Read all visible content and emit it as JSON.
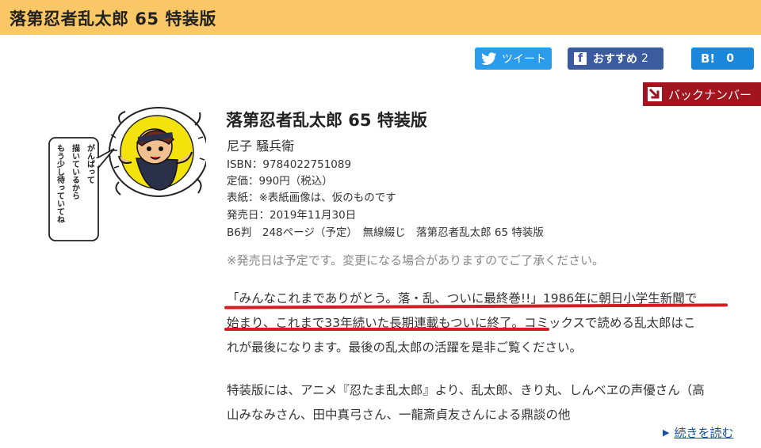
{
  "page": {
    "header_title": "落第忍者乱太郎 65 特装版"
  },
  "share": {
    "tweet_label": "ツイート",
    "fb_icon": "f",
    "fb_label": "おすすめ",
    "fb_count": "2",
    "hatena_icon": "B!",
    "hatena_count": "0"
  },
  "back_number": {
    "label": "バックナンバー"
  },
  "illustration": {
    "speech_col1": "がんばって",
    "speech_col2": "描いているから",
    "speech_col3": "もう少し待っていてね"
  },
  "book": {
    "title": "落第忍者乱太郎 65 特装版",
    "author": "尼子 騒兵衛",
    "isbn": "ISBN：9784022751089",
    "price": "定価：990円（税込）",
    "cover_note": "表紙：※表紙画像は、仮のものです",
    "release_date": "発売日：2019年11月30日",
    "format": "B6判　248ページ（予定）　無線綴じ　落第忍者乱太郎 65 特装版"
  },
  "notice": "※発売日は予定です。変更になる場合がありますのでご了承ください。",
  "description": {
    "p1": [
      "「みんなこれまでありがとう。落・乱、ついに最終巻!!」1986年に朝日小学生新聞で",
      "始まり、これまで33年続いた長期連載もついに終了。コミックスで読める乱太郎はこ",
      "れが最後になります。最後の乱太郎の活躍を是非ご覧ください。"
    ],
    "p2": [
      "特装版には、アニメ『忍たま乱太郎』より、乱太郎、きり丸、しんべヱの声優さん（高",
      "山みなみさん、田中真弓さん、一龍斎貞友さんによる鼎談の他"
    ]
  },
  "read_more": {
    "label": "続きを読む"
  },
  "colors": {
    "header_bg": "#f9c765",
    "tweet": "#2b9bec",
    "facebook": "#3b5b9e",
    "hatena": "#1b87da",
    "back_number": "#a0151e",
    "underline": "#d31c24",
    "link": "#1a4fa0"
  }
}
